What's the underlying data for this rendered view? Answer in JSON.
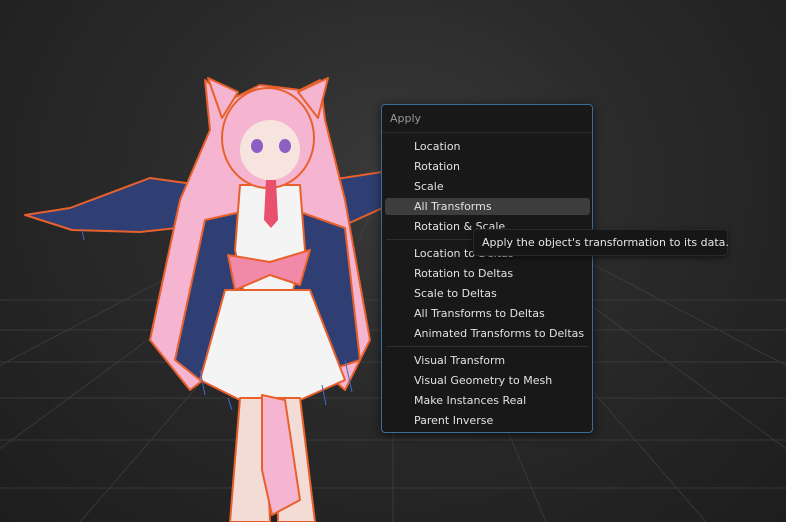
{
  "menu": {
    "title": "Apply",
    "groups": [
      [
        {
          "label": "Location"
        },
        {
          "label": "Rotation"
        },
        {
          "label": "Scale"
        },
        {
          "label": "All Transforms",
          "highlighted": true
        },
        {
          "label": "Rotation & Scale"
        }
      ],
      [
        {
          "label": "Location to Deltas"
        },
        {
          "label": "Rotation to Deltas"
        },
        {
          "label": "Scale to Deltas"
        },
        {
          "label": "All Transforms to Deltas"
        },
        {
          "label": "Animated Transforms to Deltas"
        }
      ],
      [
        {
          "label": "Visual Transform"
        },
        {
          "label": "Visual Geometry to Mesh"
        },
        {
          "label": "Make Instances Real"
        },
        {
          "label": "Parent Inverse"
        }
      ]
    ]
  },
  "tooltip": {
    "text": "Apply the object's transformation to its data."
  },
  "colors": {
    "viewport_bg": "#2a2a2a",
    "menu_bg": "#181818",
    "menu_border": "#3b6d9c",
    "highlight": "#3d3d3d",
    "selection_outline": "#e8602c",
    "hair": "#f5b5d0",
    "jacket": "#2f3f73",
    "skirt": "#f4f4f4"
  }
}
